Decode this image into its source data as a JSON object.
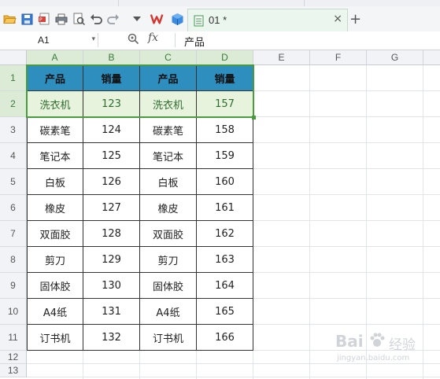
{
  "toolbar": {
    "icons": [
      "open-folder-icon",
      "save-icon",
      "export-pdf-icon",
      "print-icon",
      "print-preview-icon",
      "undo-icon",
      "redo-icon",
      "dropdown-icon",
      "wps-logo-icon",
      "cube-icon"
    ],
    "tab": {
      "title": "01 *",
      "close": "×"
    },
    "new_tab": "+"
  },
  "formula_bar": {
    "name_box": "A1",
    "dropdown": "▾",
    "fx": "fx",
    "content": "产品"
  },
  "columns": [
    "A",
    "B",
    "C",
    "D",
    "E",
    "F",
    "G"
  ],
  "rows": [
    "1",
    "2",
    "3",
    "4",
    "5",
    "6",
    "7",
    "8",
    "9",
    "10",
    "11",
    "12",
    "13"
  ],
  "table": [
    [
      "产品",
      "销量",
      "产品",
      "销量"
    ],
    [
      "洗衣机",
      "123",
      "洗衣机",
      "157"
    ],
    [
      "碳素笔",
      "124",
      "碳素笔",
      "158"
    ],
    [
      "笔记本",
      "125",
      "笔记本",
      "159"
    ],
    [
      "白板",
      "126",
      "白板",
      "160"
    ],
    [
      "橡皮",
      "127",
      "橡皮",
      "161"
    ],
    [
      "双面胶",
      "128",
      "双面胶",
      "162"
    ],
    [
      "剪刀",
      "129",
      "剪刀",
      "163"
    ],
    [
      "固体胶",
      "130",
      "固体胶",
      "164"
    ],
    [
      "A4纸",
      "131",
      "A4纸",
      "165"
    ],
    [
      "订书机",
      "132",
      "订书机",
      "166"
    ]
  ],
  "colors": {
    "header_fill": "#2e8fbf",
    "selection": "#4a9a3f",
    "selected_fill": "#e7f3dd"
  },
  "watermark": {
    "brand": "Bai",
    "suffix": "经验",
    "sub": "jingyan.baidu.com"
  }
}
